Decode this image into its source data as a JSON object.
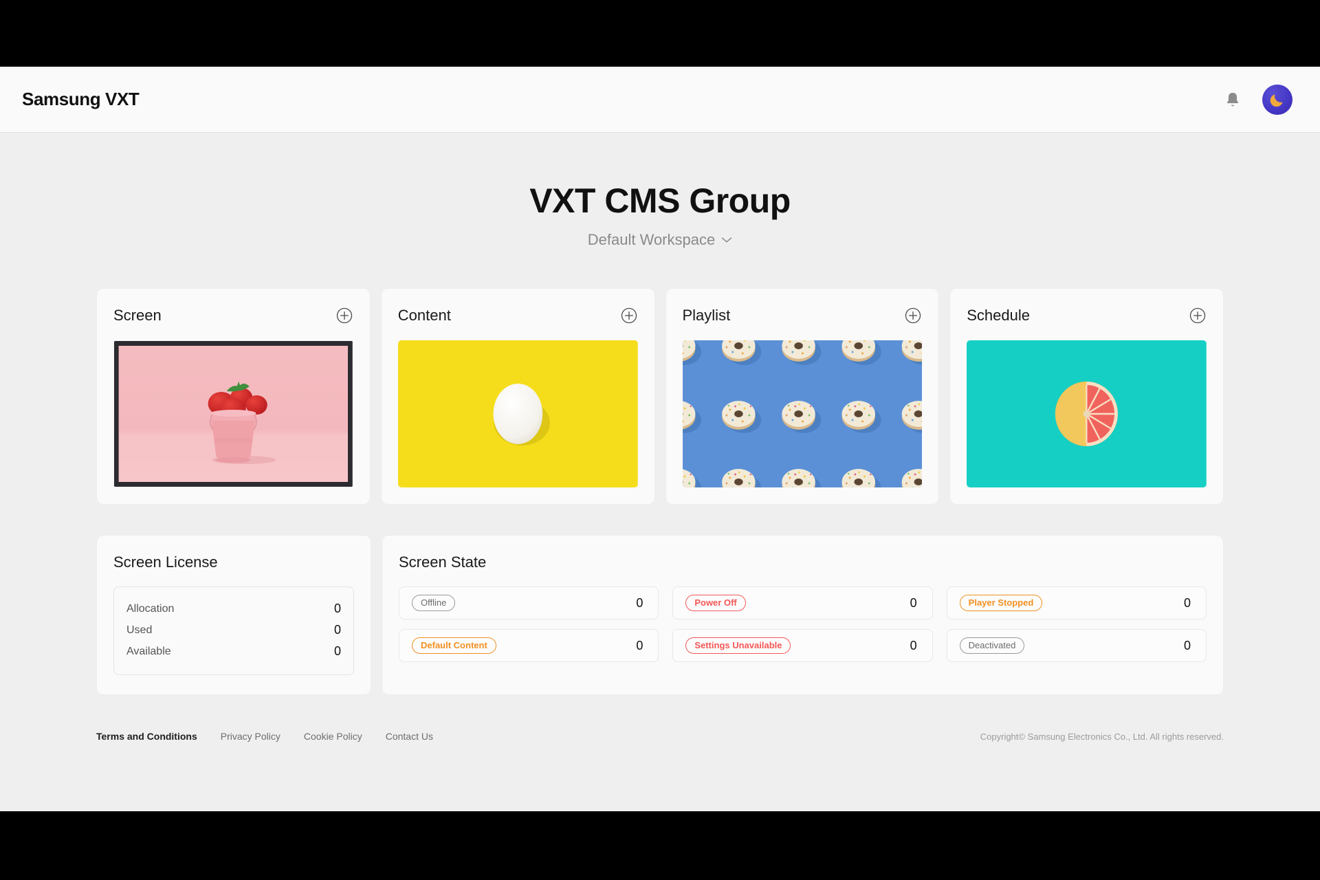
{
  "header": {
    "brand": "Samsung VXT",
    "notification_icon": "bell-icon",
    "avatar_icon": "moon-avatar-icon"
  },
  "page": {
    "title": "VXT CMS Group",
    "workspace": "Default Workspace",
    "workspace_chevron": "chevron-down-icon"
  },
  "cards": [
    {
      "title": "Screen",
      "add_icon": "plus-circle-icon",
      "thumb": "screen-strawberries-thumbnail"
    },
    {
      "title": "Content",
      "add_icon": "plus-circle-icon",
      "thumb": "content-egg-thumbnail"
    },
    {
      "title": "Playlist",
      "add_icon": "plus-circle-icon",
      "thumb": "playlist-donuts-thumbnail"
    },
    {
      "title": "Schedule",
      "add_icon": "plus-circle-icon",
      "thumb": "schedule-grapefruit-thumbnail"
    }
  ],
  "screen_license": {
    "title": "Screen License",
    "rows": [
      {
        "label": "Allocation",
        "value": "0"
      },
      {
        "label": "Used",
        "value": "0"
      },
      {
        "label": "Available",
        "value": "0"
      }
    ]
  },
  "screen_state": {
    "title": "Screen State",
    "items": [
      {
        "badge": "Offline",
        "tone": "gray",
        "value": "0"
      },
      {
        "badge": "Power Off",
        "tone": "red",
        "value": "0"
      },
      {
        "badge": "Player Stopped",
        "tone": "orange",
        "value": "0"
      },
      {
        "badge": "Default Content",
        "tone": "orange",
        "value": "0"
      },
      {
        "badge": "Settings Unavailable",
        "tone": "red",
        "value": "0"
      },
      {
        "badge": "Deactivated",
        "tone": "gray",
        "value": "0"
      }
    ]
  },
  "footer": {
    "links": [
      {
        "label": "Terms and Conditions",
        "emphasis": true
      },
      {
        "label": "Privacy Policy",
        "emphasis": false
      },
      {
        "label": "Cookie Policy",
        "emphasis": false
      },
      {
        "label": "Contact Us",
        "emphasis": false
      }
    ],
    "copyright": "Copyright© Samsung Electronics Co., Ltd. All rights reserved."
  },
  "colors": {
    "page_bg": "#efefef",
    "surface": "#fafafa",
    "badge_orange": "#f29021",
    "badge_red": "#f45757",
    "badge_gray": "#6b6b6b",
    "thumb_screen_bg": "#f2b8bd",
    "thumb_content_bg": "#f5dd1b",
    "thumb_playlist_bg": "#5b90d6",
    "thumb_schedule_bg": "#16cfc4"
  }
}
